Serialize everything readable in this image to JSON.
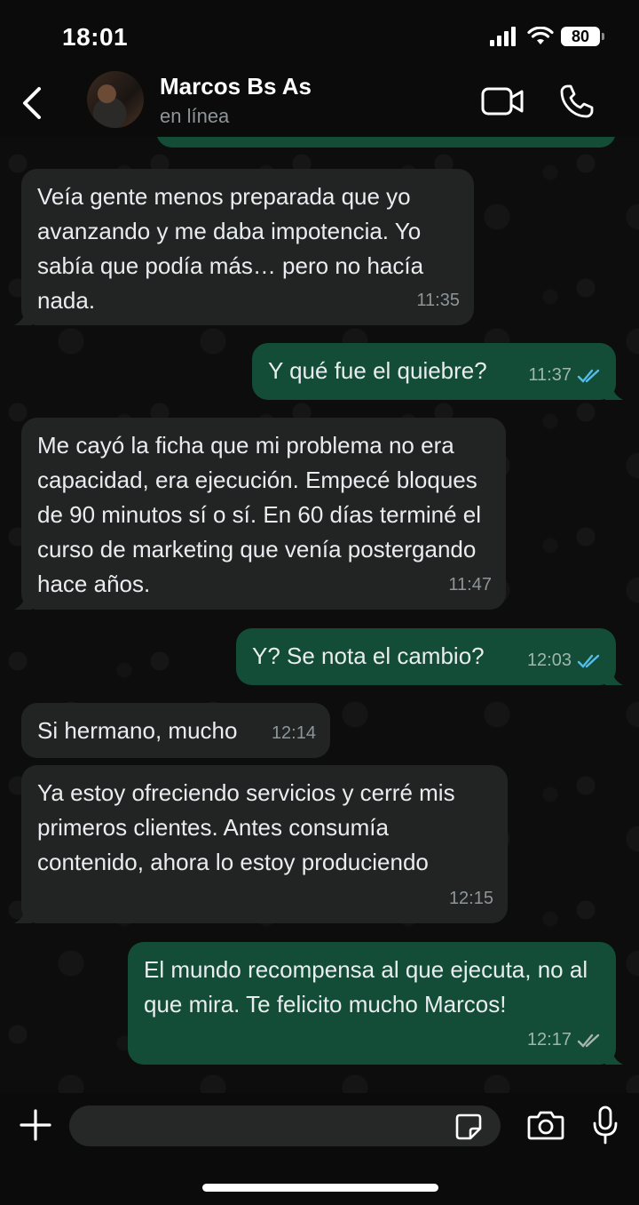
{
  "status_bar": {
    "time": "18:01",
    "battery": "80"
  },
  "header": {
    "name": "Marcos Bs As",
    "status": "en línea"
  },
  "messages": [
    {
      "text": "Veía gente menos preparada que yo avanzando y me daba impotencia. Yo sabía que podía más… pero no hacía nada.",
      "time": "11:35",
      "direction": "in"
    },
    {
      "text": "Y qué fue el quiebre?",
      "time": "11:37",
      "direction": "out",
      "read": true
    },
    {
      "text": "Me cayó la ficha que mi problema no era capacidad, era ejecución. Empecé bloques de 90 minutos sí o sí. En 60 días terminé el curso de marketing que venía postergando hace años.",
      "time": "11:47",
      "direction": "in"
    },
    {
      "text": "Y? Se nota el cambio?",
      "time": "12:03",
      "direction": "out",
      "read": true
    },
    {
      "text": "Si hermano, mucho",
      "time": "12:14",
      "direction": "in"
    },
    {
      "text": "Ya estoy ofreciendo servicios y cerré mis primeros clientes. Antes consumía contenido, ahora lo estoy produciendo",
      "time": "12:15",
      "direction": "in"
    },
    {
      "text": "El mundo recompensa al que ejecuta, no al que mira. Te felicito mucho Marcos!",
      "time": "12:17",
      "direction": "out",
      "read": false
    }
  ],
  "composer": {
    "placeholder": ""
  },
  "colors": {
    "incoming": "#222424",
    "outgoing": "#134d37",
    "read_ticks": "#53bdeb",
    "delivered_ticks": "#8d9598"
  },
  "icons": [
    "back-arrow-icon",
    "video-camera-icon",
    "phone-icon",
    "plus-icon",
    "sticker-icon",
    "camera-icon",
    "microphone-icon",
    "double-check-icon"
  ]
}
